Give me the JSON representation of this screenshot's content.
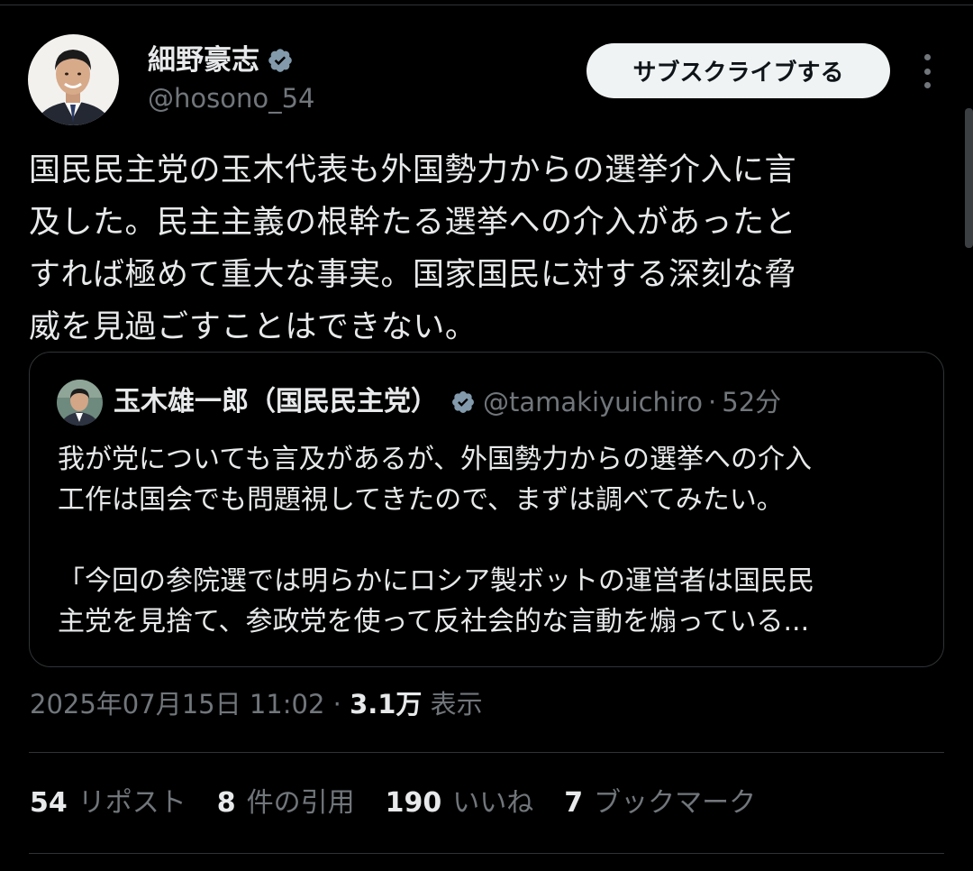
{
  "author": {
    "name": "細野豪志",
    "handle": "@hosono_54"
  },
  "subscribe_label": "サブスクライブする",
  "tweet_text": "国民民主党の玉木代表も外国勢力からの選挙介入に言\n及した。民主主義の根幹たる選挙への介入があったと\nすれば極めて重大な事実。国家国民に対する深刻な脅\n威を見過ごすことはできない。",
  "quote": {
    "name": "玉木雄一郎（国民民主党）",
    "handle": "@tamakiyuichiro",
    "separator": "·",
    "time": "52分",
    "text": "我が党についても言及があるが、外国勢力からの選挙への介入\n工作は国会でも問題視してきたので、まずは調べてみたい。\n\n「今回の参院選では明らかにロシア製ボットの運営者は国民民\n主党を見捨て、参政党を使って反社会的な言動を煽っている..."
  },
  "meta": {
    "datetime": "2025年07月15日 11:02",
    "separator": " · ",
    "views": "3.1万",
    "views_label": " 表示"
  },
  "stats": [
    {
      "count": "54",
      "label": "リポスト"
    },
    {
      "count": "8",
      "label": "件の引用"
    },
    {
      "count": "190",
      "label": "いいね"
    },
    {
      "count": "7",
      "label": "ブックマーク"
    }
  ],
  "colors": {
    "background": "#000000",
    "text": "#e7e9ea",
    "secondary": "#71767b",
    "border": "#2f3336",
    "verified": "#829aab"
  }
}
